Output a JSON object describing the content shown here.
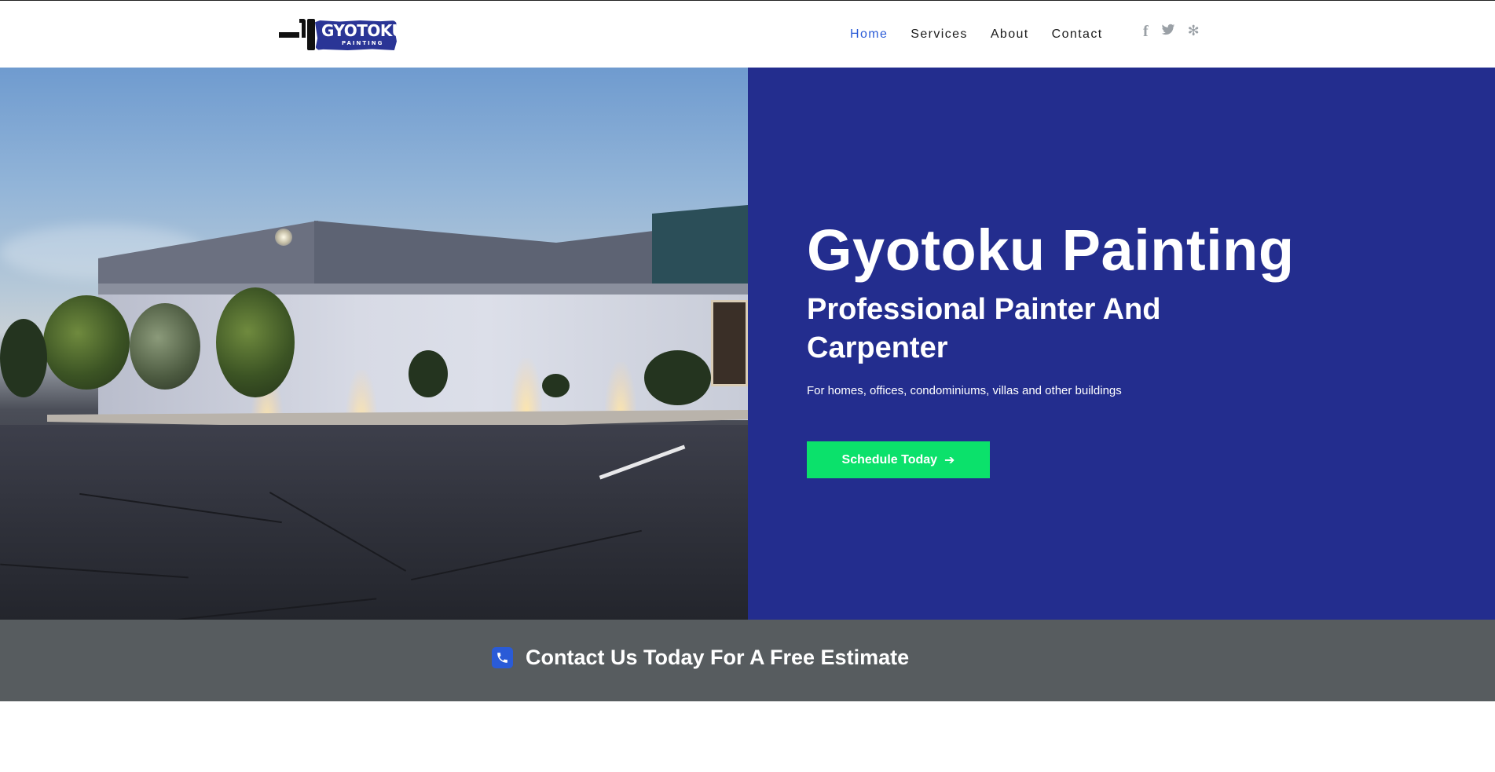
{
  "brand": {
    "logo_text": "GYOTOKU",
    "logo_subtext": "PAINTING"
  },
  "nav": {
    "items": [
      {
        "label": "Home",
        "active": true
      },
      {
        "label": "Services",
        "active": false
      },
      {
        "label": "About",
        "active": false
      },
      {
        "label": "Contact",
        "active": false
      }
    ]
  },
  "social": {
    "icons": [
      "facebook-icon",
      "twitter-icon",
      "yelp-icon"
    ],
    "glyphs": [
      "f",
      "🐦",
      "✻"
    ]
  },
  "hero": {
    "title": "Gyotoku Painting",
    "subtitle": "Professional Painter And Carpenter",
    "description": "For homes, offices, condominiums, villas and other buildings",
    "cta_label": "Schedule Today",
    "cta_icon": "arrow-right-icon"
  },
  "contact_bar": {
    "icon": "phone-icon",
    "text": "Contact Us Today For A Free Estimate"
  },
  "colors": {
    "hero_panel": "#232d8e",
    "cta": "#0be16b",
    "nav_active": "#2a5bd7",
    "contact_bar": "#575c5f",
    "phone_icon": "#2a5bd7"
  }
}
